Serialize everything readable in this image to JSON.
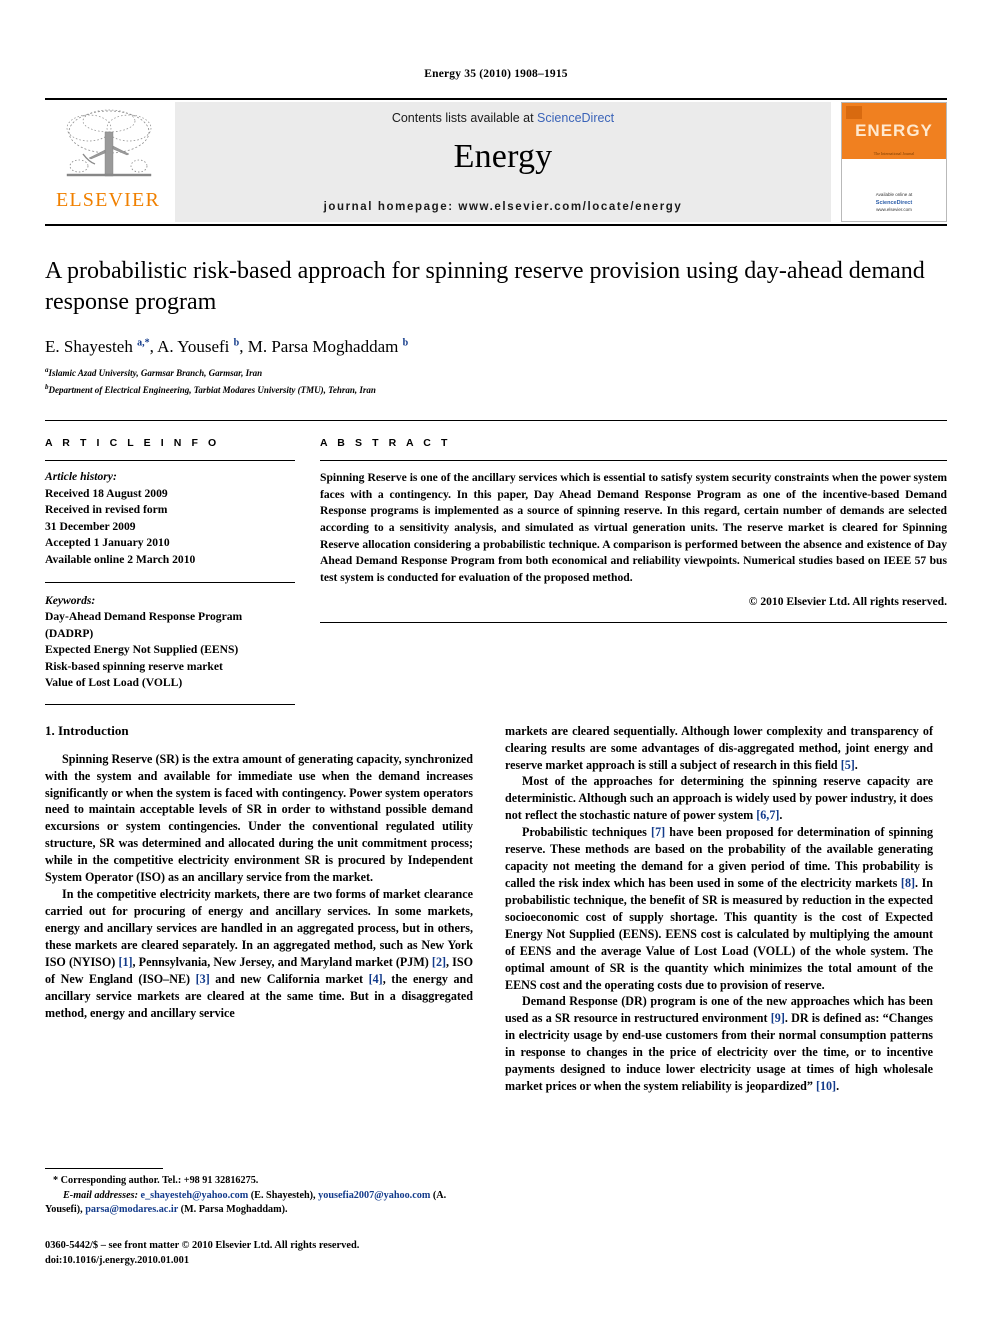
{
  "running_head": "Energy 35 (2010) 1908–1915",
  "masthead": {
    "contents_prefix": "Contents lists available at ",
    "sciencedirect": "ScienceDirect",
    "journal_name": "Energy",
    "homepage": "journal homepage: www.elsevier.com/locate/energy",
    "publisher_wordmark": "ELSEVIER",
    "cover": {
      "title_word": "ENERGY",
      "subtitle": "The International Journal",
      "footer_line1": "Available online at",
      "footer_line2": "ScienceDirect",
      "footer_line3": "www.elsevier.com"
    },
    "link_color": "#3a63b8",
    "brand_orange": "#F08000",
    "band_gray": "#ebebeb"
  },
  "article": {
    "title": "A probabilistic risk-based approach for spinning reserve provision using day-ahead demand response program",
    "authors_html": "E. Shayesteh <sup>a,*</sup>, A. Yousefi <sup>b</sup>, M. Parsa Moghaddam <sup>b</sup>",
    "affiliations": [
      {
        "marker": "a",
        "text": "Islamic Azad University, Garmsar Branch, Garmsar, Iran"
      },
      {
        "marker": "b",
        "text": "Department of Electrical Engineering, Tarbiat Modares University (TMU), Tehran, Iran"
      }
    ]
  },
  "article_info": {
    "heading": "A R T I C L E   I N F O",
    "history_label": "Article history:",
    "history": [
      "Received 18 August 2009",
      "Received in revised form",
      "31 December 2009",
      "Accepted 1 January 2010",
      "Available online 2 March 2010"
    ],
    "keywords_label": "Keywords:",
    "keywords": [
      "Day-Ahead Demand Response Program",
      "(DADRP)",
      "Expected Energy Not Supplied (EENS)",
      "Risk-based spinning reserve market",
      "Value of Lost Load (VOLL)"
    ]
  },
  "abstract": {
    "heading": "A B S T R A C T",
    "text": "Spinning Reserve is one of the ancillary services which is essential to satisfy system security constraints when the power system faces with a contingency. In this paper, Day Ahead Demand Response Program as one of the incentive-based Demand Response programs is implemented as a source of spinning reserve. In this regard, certain number of demands are selected according to a sensitivity analysis, and simulated as virtual generation units. The reserve market is cleared for Spinning Reserve allocation considering a probabilistic technique. A comparison is performed between the absence and existence of Day Ahead Demand Response Program from both economical and reliability viewpoints. Numerical studies based on IEEE 57 bus test system is conducted for evaluation of the proposed method.",
    "copyright": "© 2010 Elsevier Ltd. All rights reserved."
  },
  "body": {
    "section_title": "1. Introduction",
    "left_paragraphs": [
      "Spinning Reserve (SR) is the extra amount of generating capacity, synchronized with the system and available for immediate use when the demand increases significantly or when the system is faced with contingency. Power system operators need to maintain acceptable levels of SR in order to withstand possible demand excursions or system contingencies. Under the conventional regulated utility structure, SR was determined and allocated during the unit commitment process; while in the competitive electricity environment SR is procured by Independent System Operator (ISO) as an ancillary service from the market."
    ],
    "left_para2_html": "In the competitive electricity markets, there are two forms of market clearance carried out for procuring of energy and ancillary services. In some markets, energy and ancillary services are handled in an aggregated process, but in others, these markets are cleared separately. In an aggregated method, such as New York ISO (NYISO) <span class=\"ref\">[1]</span>, Pennsylvania, New Jersey, and Maryland market (PJM) <span class=\"ref\">[2]</span>, ISO of New England (ISO–NE) <span class=\"ref\">[3]</span> and new California market <span class=\"ref\">[4]</span>, the energy and ancillary service markets are cleared at the same time. But in a disaggregated method, energy and ancillary service",
    "right_para1_html": "markets are cleared sequentially. Although lower complexity and transparency of clearing results are some advantages of dis-aggregated method, joint energy and reserve market approach is still a subject of research in this field <span class=\"ref\">[5]</span>.",
    "right_para2_html": "Most of the approaches for determining the spinning reserve capacity are deterministic. Although such an approach is widely used by power industry, it does not reflect the stochastic nature of power system <span class=\"ref\">[6,7]</span>.",
    "right_para3_html": "Probabilistic techniques <span class=\"ref\">[7]</span> have been proposed for determination of spinning reserve. These methods are based on the probability of the available generating capacity not meeting the demand for a given period of time. This probability is called the risk index which has been used in some of the electricity markets <span class=\"ref\">[8]</span>. In probabilistic technique, the benefit of SR is measured by reduction in the expected socioeconomic cost of supply shortage. This quantity is the cost of Expected Energy Not Supplied (EENS). EENS cost is calculated by multiplying the amount of EENS and the average Value of Lost Load (VOLL) of the whole system. The optimal amount of SR is the quantity which minimizes the total amount of the EENS cost and the operating costs due to provision of reserve.",
    "right_para4_html": "Demand Response (DR) program is one of the new approaches which has been used as a SR resource in restructured environment <span class=\"ref\">[9]</span>. DR is defined as: “Changes in electricity usage by end-use customers from their normal consumption patterns in response to changes in the price of electricity over the time, or to incentive payments designed to induce lower electricity usage at times of high wholesale market prices or when the system reliability is jeopardized” <span class=\"ref\">[10]</span>."
  },
  "footnote": {
    "corresponding_html": "* Corresponding author. Tel.: +98 91 32816275.",
    "emails_html": "<span class=\"lbl-i\">E-mail addresses:</span> <span class=\"mail\">e_shayesteh@yahoo.com</span> (E. Shayesteh), <span class=\"mail\">yousefia2007@yahoo.com</span> (A. Yousefi), <span class=\"mail\">parsa@modares.ac.ir</span> (M. Parsa Moghaddam).",
    "issn_line1": "0360-5442/$ – see front matter © 2010 Elsevier Ltd. All rights reserved.",
    "issn_line2": "doi:10.1016/j.energy.2010.01.001"
  }
}
